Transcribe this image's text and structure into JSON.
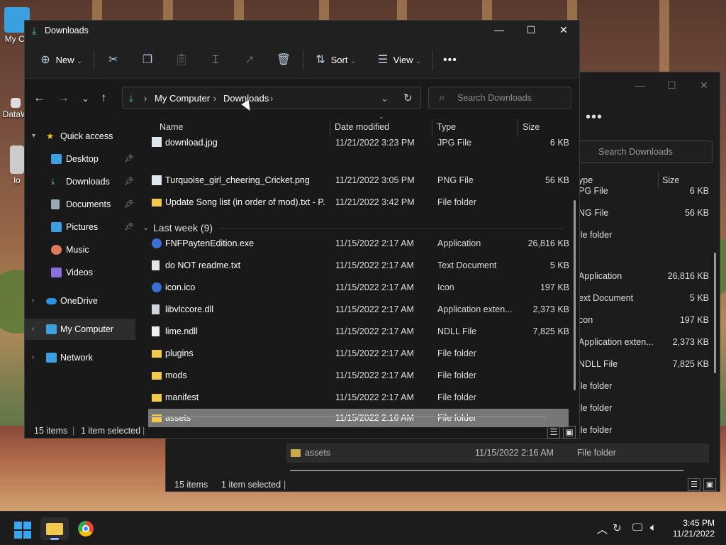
{
  "desktop": {
    "icons": [
      {
        "label": "My Co"
      },
      {
        "label": "DataW"
      },
      {
        "label": "lo"
      }
    ]
  },
  "background_window": {
    "search_placeholder": "Search Downloads",
    "columns": {
      "type": "ype",
      "size": "Size"
    },
    "rows": [
      {
        "type": "PG File",
        "size": "6 KB"
      },
      {
        "type": "NG File",
        "size": "56 KB"
      },
      {
        "type": "ile folder",
        "size": ""
      },
      {
        "type": "Application",
        "size": "26,816 KB"
      },
      {
        "type": "ext Document",
        "size": "5 KB"
      },
      {
        "type": "con",
        "size": "197 KB"
      },
      {
        "type": "Application exten...",
        "size": "2,373 KB"
      },
      {
        "type": "NDLL File",
        "size": "7,825 KB"
      },
      {
        "type": "ile folder",
        "size": ""
      },
      {
        "type": "ile folder",
        "size": ""
      },
      {
        "type": "ile folder",
        "size": ""
      }
    ],
    "selected_row": {
      "name": "assets",
      "date": "11/15/2022 2:16 AM",
      "type": "File folder"
    },
    "status_items": "15 items",
    "status_selected": "1 item selected"
  },
  "window": {
    "title": "Downloads",
    "toolbar": {
      "new": "New",
      "sort": "Sort",
      "view": "View"
    },
    "address": {
      "root": "My Computer",
      "folder": "Downloads"
    },
    "search_placeholder": "Search Downloads",
    "nav": [
      {
        "label": "Quick access",
        "icon": "star-icon",
        "color": "#f5c518"
      },
      {
        "label": "Desktop",
        "icon": "desktop-icon",
        "color": "#3aa0e0",
        "pinned": true
      },
      {
        "label": "Downloads",
        "icon": "download-icon",
        "color": "#4fc2a0",
        "pinned": true
      },
      {
        "label": "Documents",
        "icon": "document-icon",
        "color": "#9aa7b5",
        "pinned": true
      },
      {
        "label": "Pictures",
        "icon": "pictures-icon",
        "color": "#3aa0e0",
        "pinned": true
      },
      {
        "label": "Music",
        "icon": "music-icon",
        "color": "#e07a5f"
      },
      {
        "label": "Videos",
        "icon": "videos-icon",
        "color": "#8a6fe0"
      },
      {
        "label": "OneDrive",
        "icon": "cloud-icon",
        "color": "#2f8fe0"
      },
      {
        "label": "My Computer",
        "icon": "computer-icon",
        "color": "#3aa0e0"
      },
      {
        "label": "Network",
        "icon": "network-icon",
        "color": "#3aa0e0"
      }
    ],
    "columns": {
      "name": "Name",
      "date": "Date modified",
      "type": "Type",
      "size": "Size"
    },
    "top_rows": [
      {
        "name": "download.jpg",
        "date": "11/21/2022 3:23 PM",
        "type": "JPG File",
        "size": "6 KB",
        "icon": "image-file-icon"
      },
      {
        "name": "Turquoise_girl_cheering_Cricket.png",
        "date": "11/21/2022 3:05 PM",
        "type": "PNG File",
        "size": "56 KB",
        "icon": "image-file-icon"
      },
      {
        "name": "Update Song list (in order of mod).txt - P...",
        "date": "11/21/2022 3:42 PM",
        "type": "File folder",
        "size": "",
        "icon": "folder-icon"
      }
    ],
    "group": {
      "label": "Last week (9)"
    },
    "rows": [
      {
        "name": "FNFPaytenEdition.exe",
        "date": "11/15/2022 2:17 AM",
        "type": "Application",
        "size": "26,816 KB",
        "icon": "app-icon"
      },
      {
        "name": "do NOT readme.txt",
        "date": "11/15/2022 2:17 AM",
        "type": "Text Document",
        "size": "5 KB",
        "icon": "text-file-icon"
      },
      {
        "name": "icon.ico",
        "date": "11/15/2022 2:17 AM",
        "type": "Icon",
        "size": "197 KB",
        "icon": "app-icon"
      },
      {
        "name": "libvlccore.dll",
        "date": "11/15/2022 2:17 AM",
        "type": "Application exten...",
        "size": "2,373 KB",
        "icon": "dll-file-icon"
      },
      {
        "name": "lime.ndll",
        "date": "11/15/2022 2:17 AM",
        "type": "NDLL File",
        "size": "7,825 KB",
        "icon": "file-icon"
      },
      {
        "name": "plugins",
        "date": "11/15/2022 2:17 AM",
        "type": "File folder",
        "size": "",
        "icon": "folder-icon"
      },
      {
        "name": "mods",
        "date": "11/15/2022 2:17 AM",
        "type": "File folder",
        "size": "",
        "icon": "folder-icon"
      },
      {
        "name": "manifest",
        "date": "11/15/2022 2:17 AM",
        "type": "File folder",
        "size": "",
        "icon": "folder-icon"
      },
      {
        "name": "assets",
        "date": "11/15/2022 2:16 AM",
        "type": "File folder",
        "size": "",
        "icon": "folder-icon",
        "selected": true
      }
    ],
    "status_items": "15 items",
    "status_selected": "1 item selected"
  },
  "taskbar": {
    "time": "3:45 PM",
    "date": "11/21/2022"
  },
  "colors": {
    "folder": "#f2c94c",
    "accent": "#4fc2a0",
    "selection": "#777777"
  }
}
